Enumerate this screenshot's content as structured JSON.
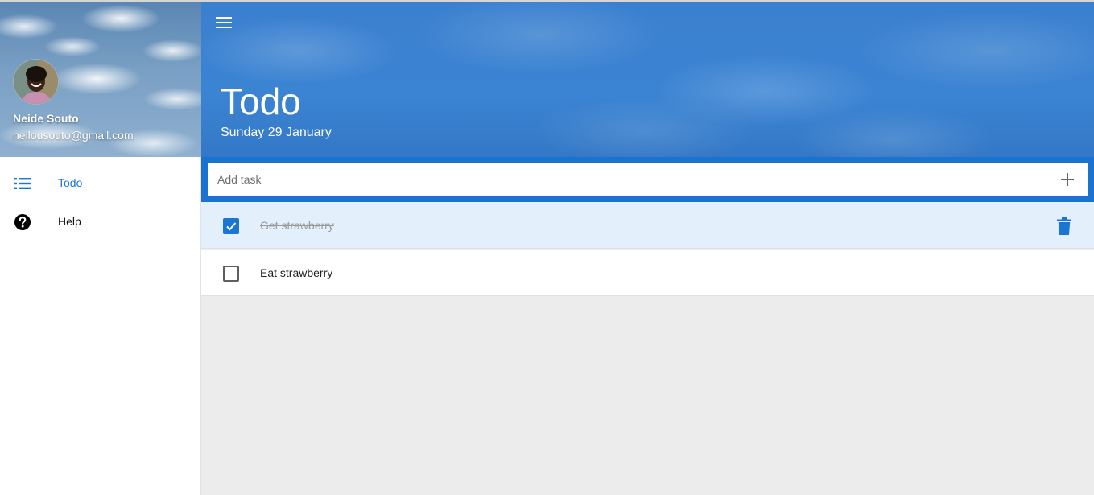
{
  "sidebar": {
    "user": {
      "name": "Neide Souto",
      "email": "neilousouto@gmail.com"
    },
    "items": [
      {
        "label": "Todo",
        "icon": "list-icon",
        "active": true
      },
      {
        "label": "Help",
        "icon": "help-icon",
        "active": false
      }
    ]
  },
  "header": {
    "menu_icon": "menu-icon",
    "title": "Todo",
    "date": "Sunday 29 January"
  },
  "add_task": {
    "placeholder": "Add task",
    "value": "",
    "button_icon": "plus-icon"
  },
  "tasks": [
    {
      "text": "Get strawberry",
      "done": true,
      "highlighted": true,
      "delete_icon": "trash-icon"
    },
    {
      "text": "Eat strawberry",
      "done": false,
      "highlighted": false
    }
  ],
  "colors": {
    "accent": "#1976d2",
    "hero_blue": "#3b84d3",
    "add_bar_blue": "#1a73d0",
    "selected_row": "#e3f0fc",
    "background": "#ececec"
  }
}
